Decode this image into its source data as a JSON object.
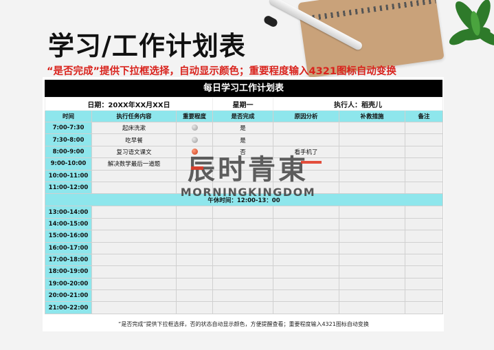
{
  "title": "学习/工作计划表",
  "subtitle": "“是否完成”提供下拉框选择，自动显示颜色；重要程度输入4321图标自动变换",
  "table_title": "每日学习工作计划表",
  "info": {
    "date": "日期：20XX年XX月XX日",
    "weekday": "星期一",
    "executor": "执行人：稻壳儿"
  },
  "headers": [
    "时间",
    "执行任务内容",
    "重要程度",
    "是否完成",
    "原因分析",
    "补救措施",
    "备注"
  ],
  "morning_rows": [
    {
      "time": "7:00-7:30",
      "task": "起床洗漱",
      "importance": "grey",
      "done": "是",
      "reason": ""
    },
    {
      "time": "7:30-8:00",
      "task": "吃早餐",
      "importance": "grey",
      "done": "是",
      "reason": ""
    },
    {
      "time": "8:00-9:00",
      "task": "复习语文课文",
      "importance": "red",
      "done": "否",
      "reason": "看手机了"
    },
    {
      "time": "9:00-10:00",
      "task": "解决数学最后一道题",
      "importance": "",
      "done": "",
      "reason": ""
    },
    {
      "time": "10:00-11:00",
      "task": "",
      "importance": "",
      "done": "",
      "reason": ""
    },
    {
      "time": "11:00-12:00",
      "task": "",
      "importance": "",
      "done": "",
      "reason": ""
    }
  ],
  "lunch": "午休时间：12:00-13：00",
  "afternoon_rows": [
    {
      "time": "13:00-14:00"
    },
    {
      "time": "14:00-15:00"
    },
    {
      "time": "15:00-16:00"
    },
    {
      "time": "16:00-17:00"
    },
    {
      "time": "17:00-18:00"
    },
    {
      "time": "18:00-19:00"
    },
    {
      "time": "19:00-20:00"
    },
    {
      "time": "20:00-21:00"
    },
    {
      "time": "21:00-22:00"
    }
  ],
  "footer": "“是否完成”提供下拉框选择，否的状态自动显示颜色，方便提醒查看；重要程度输入4321图标自动变换",
  "watermark": {
    "cn": "辰时青東",
    "en": "MORNINGKINGDOM"
  },
  "colors": {
    "header_cyan": "#8ee6ec",
    "accent_red": "#d9231d",
    "title_bar": "#000000"
  }
}
